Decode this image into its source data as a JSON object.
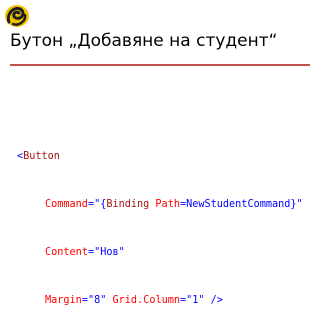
{
  "slide": {
    "title": "Бутон „Добавяне на студент“",
    "accent_color": "#c0504d",
    "logo_icon": "knot-logo-icon"
  },
  "code": {
    "line1": {
      "open": "<",
      "tag": "Button"
    },
    "line2": {
      "attr1": "Command",
      "eq1": "=\"{",
      "binding": "Binding",
      "path_attr": "Path",
      "path_eq": "=",
      "path_val": "NewStudentCommand",
      "close1": "}\""
    },
    "line3": {
      "attr": "Content",
      "eq": "=\"",
      "val": "Нов",
      "close": "\""
    },
    "line4": {
      "attr1": "Margin",
      "eq1": "=\"",
      "val1": "8",
      "close1": "\"",
      "attr2": "Grid.Column",
      "eq2": "=\"",
      "val2": "1",
      "close2": "\"",
      "end": " />"
    }
  }
}
